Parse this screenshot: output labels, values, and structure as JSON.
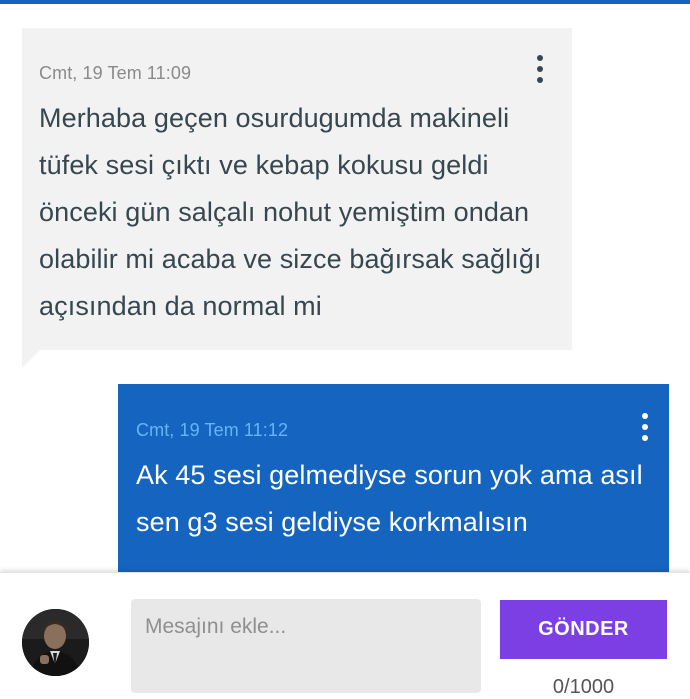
{
  "colors": {
    "accent": "#1565c0",
    "received_bubble": "#f2f2f2",
    "sent_bubble": "#1565c0",
    "send_button": "#7b3fe4"
  },
  "messages": [
    {
      "direction": "received",
      "timestamp": "Cmt, 19 Tem 11:09",
      "text": "Merhaba geçen osurdugumda makineli tüfek sesi çıktı ve kebap kokusu geldi önceki gün salçalı nohut yemiştim ondan olabilir mi acaba ve sizce bağırsak sağlığı açısından da normal mi",
      "menu_icon": "more-vertical-icon"
    },
    {
      "direction": "sent",
      "timestamp": "Cmt, 19 Tem 11:12",
      "text": "Ak 45 sesi gelmediyse sorun yok ama asıl sen g3 sesi geldiyse korkmalısın",
      "menu_icon": "more-vertical-icon"
    }
  ],
  "composer": {
    "placeholder": "Mesajını ekle...",
    "value": "",
    "send_label": "GÖNDER",
    "char_counter": "0/1000"
  }
}
